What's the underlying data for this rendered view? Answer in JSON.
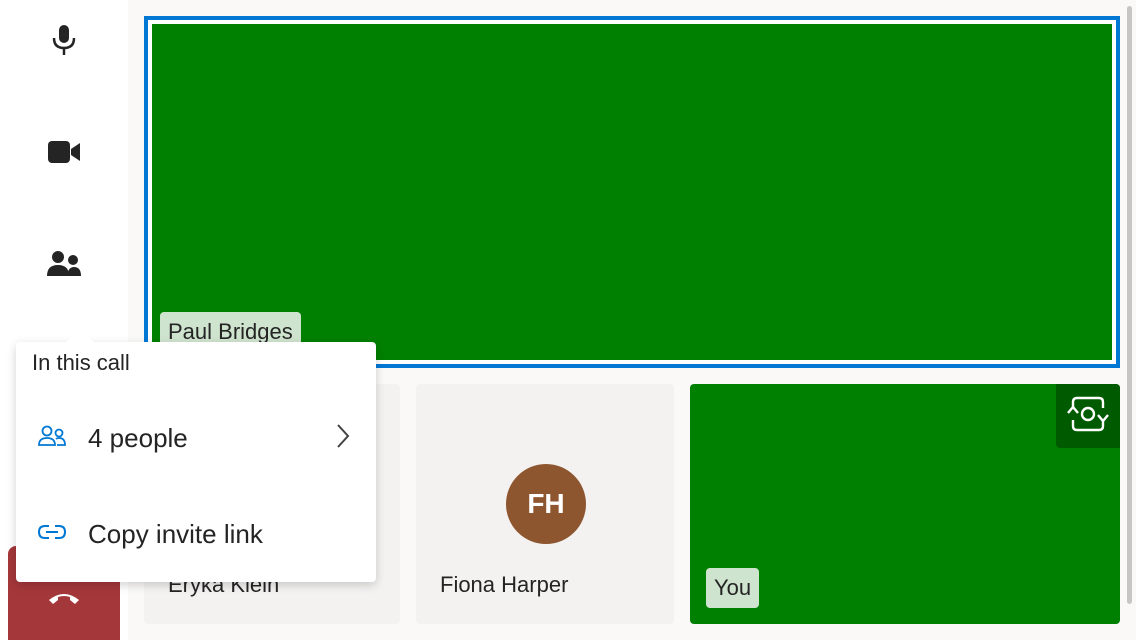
{
  "sidebar": {
    "icons": [
      "microphone-icon",
      "video-camera-icon",
      "people-icon",
      "hang-up-icon"
    ]
  },
  "main_participant": {
    "name": "Paul Bridges"
  },
  "participants": [
    {
      "name": "Eryka Klein"
    },
    {
      "name": "Fiona Harper",
      "initials": "FH",
      "avatar_color": "#8e562e"
    },
    {
      "name": "You"
    }
  ],
  "popup": {
    "title": "In this call",
    "people_label": "4 people",
    "copy_link_label": "Copy invite link"
  },
  "colors": {
    "video": "#008000",
    "accent": "#0078d4",
    "hangup": "#a4373a"
  }
}
